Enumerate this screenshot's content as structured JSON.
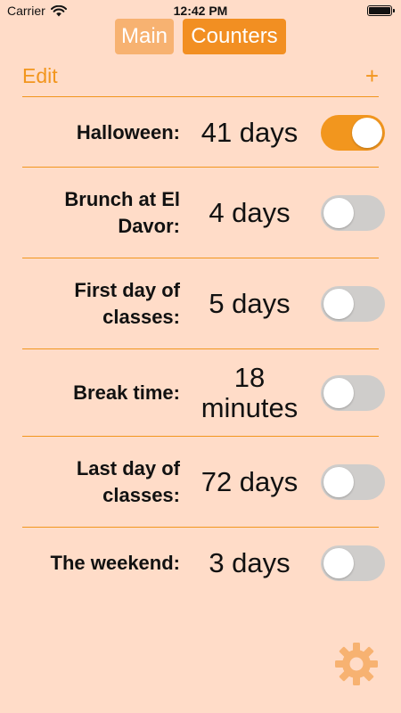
{
  "status_bar": {
    "carrier": "Carrier",
    "time": "12:42 PM"
  },
  "segment": {
    "main_label": "Main",
    "counters_label": "Counters",
    "selected": "Counters"
  },
  "toolbar": {
    "edit_label": "Edit",
    "add_label": "+"
  },
  "counters": [
    {
      "name": "Halloween:",
      "value": "41 days",
      "enabled": true
    },
    {
      "name": "Brunch at El Davor:",
      "value": "4 days",
      "enabled": false
    },
    {
      "name": "First day of classes:",
      "value": "5 days",
      "enabled": false
    },
    {
      "name": "Break time:",
      "value": "18 minutes",
      "enabled": false
    },
    {
      "name": "Last day of classes:",
      "value": "72 days",
      "enabled": false
    },
    {
      "name": "The weekend:",
      "value": "3 days",
      "enabled": false
    }
  ],
  "colors": {
    "background": "#FFDCC8",
    "accent": "#F2961E",
    "accent_light": "#F7B271",
    "toggle_off": "#CFCDCB",
    "gear": "#F7B271"
  },
  "icons": {
    "wifi": "wifi-icon",
    "battery": "battery-icon",
    "settings": "gear-icon"
  }
}
